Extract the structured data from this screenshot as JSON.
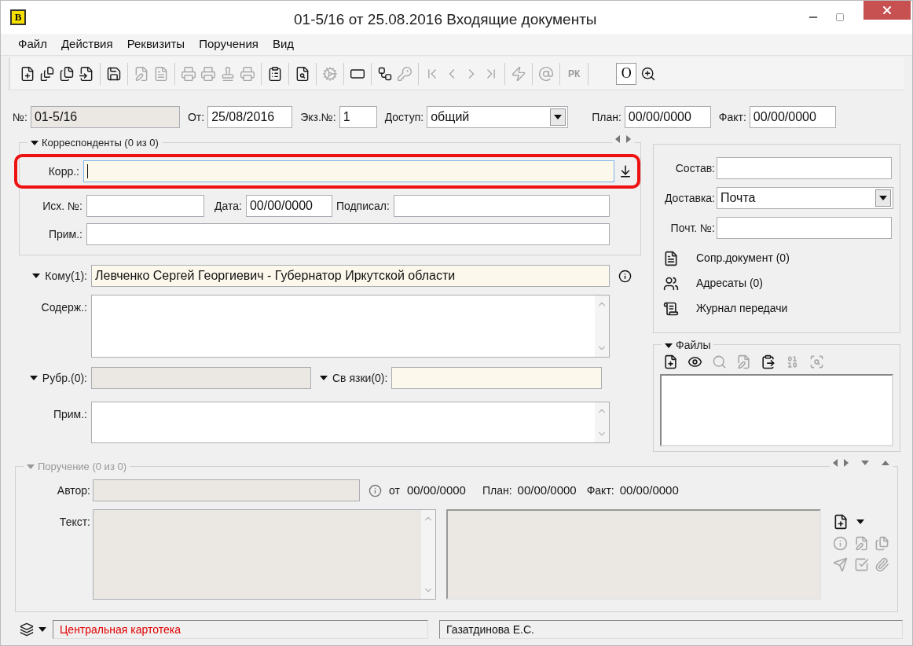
{
  "window": {
    "app_letter": "B",
    "title": "01-5/16 от 25.08.2016 Входящие документы"
  },
  "menu": [
    "Файл",
    "Действия",
    "Реквизиты",
    "Поручения",
    "Вид"
  ],
  "toolbar": [
    {
      "kind": "new",
      "disabled": false
    },
    {
      "kind": "newlist",
      "disabled": false
    },
    {
      "kind": "newcopy",
      "disabled": false
    },
    {
      "kind": "newlink",
      "disabled": false
    },
    {
      "kind": "separator"
    },
    {
      "kind": "save",
      "disabled": false
    },
    {
      "kind": "separator"
    },
    {
      "kind": "edit",
      "disabled": true
    },
    {
      "kind": "doc",
      "disabled": true
    },
    {
      "kind": "separator"
    },
    {
      "kind": "print",
      "disabled": true
    },
    {
      "kind": "printdoc",
      "disabled": true
    },
    {
      "kind": "stamp",
      "disabled": true
    },
    {
      "kind": "fax",
      "disabled": true
    },
    {
      "kind": "separator"
    },
    {
      "kind": "report",
      "disabled": false
    },
    {
      "kind": "separator"
    },
    {
      "kind": "finddoc",
      "disabled": false
    },
    {
      "kind": "separator"
    },
    {
      "kind": "gear",
      "disabled": true
    },
    {
      "kind": "separator"
    },
    {
      "kind": "field",
      "disabled": false
    },
    {
      "kind": "separator"
    },
    {
      "kind": "workflow",
      "disabled": false
    },
    {
      "kind": "key",
      "disabled": true
    },
    {
      "kind": "separator"
    },
    {
      "kind": "first",
      "disabled": true
    },
    {
      "kind": "prev",
      "disabled": true
    },
    {
      "kind": "next",
      "disabled": true
    },
    {
      "kind": "last",
      "disabled": true
    },
    {
      "kind": "separator"
    },
    {
      "kind": "lightning",
      "disabled": true
    },
    {
      "kind": "separator"
    },
    {
      "kind": "email",
      "disabled": true
    },
    {
      "kind": "separator"
    },
    {
      "kind": "lettered",
      "label": "РК",
      "disabled": true
    },
    {
      "kind": "separator"
    },
    {
      "kind": "toggle",
      "label": "О",
      "selected": true
    },
    {
      "kind": "zoom",
      "disabled": false
    }
  ],
  "header_fields": [
    {
      "label": "№:",
      "value": "01-5/16",
      "kind": "readonly"
    },
    {
      "label": "От:",
      "value": "25/08/2016",
      "kind": "text"
    },
    {
      "label": "Экз.№:",
      "value": "1",
      "kind": "text"
    },
    {
      "label": "Доступ:",
      "value": "общий",
      "kind": "select"
    },
    {
      "label": "План:",
      "value": "00/00/0000",
      "kind": "text"
    },
    {
      "label": "Факт:",
      "value": "00/00/0000",
      "kind": "text"
    }
  ],
  "correspondents": {
    "title": "Корреспонденты (0 из 0)",
    "expanded": true,
    "korr": {
      "label": "Корр.:",
      "focused": true,
      "highlighted": true
    },
    "out_number": {
      "label": "Исх. №:"
    },
    "date": {
      "label": "Дата:",
      "value": "00/00/0000"
    },
    "signed": {
      "label": "Подписал:"
    },
    "note": {
      "label": "Прим.:"
    }
  },
  "addressee": {
    "label": "Кому(1):",
    "value": "Левченко Сергей Георгиевич - Губернатор Иркутской области"
  },
  "content": {
    "label": "Содерж.:"
  },
  "rubrics": {
    "label": "Рубр.(0):"
  },
  "links": {
    "label": "Св язки(0):"
  },
  "note": {
    "label": "Прим.:"
  },
  "side_fields": [
    {
      "label": "Состав:",
      "kind": "text"
    },
    {
      "label": "Доставка:",
      "kind": "select",
      "value": "Почта"
    },
    {
      "label": "Почт. №:",
      "kind": "text"
    }
  ],
  "side_links": [
    {
      "label": "Сопр.документ (0)",
      "kind": "document"
    },
    {
      "label": "Адресаты (0)",
      "kind": "addressees"
    },
    {
      "label": "Журнал передачи",
      "kind": "journal"
    }
  ],
  "files": {
    "title": "Файлы",
    "tools": [
      {
        "kind": "new",
        "disabled": false
      },
      {
        "kind": "view",
        "disabled": false
      },
      {
        "kind": "search",
        "disabled": true
      },
      {
        "kind": "edit",
        "disabled": true
      },
      {
        "kind": "paste",
        "disabled": false
      },
      {
        "kind": "binedit",
        "disabled": true
      },
      {
        "kind": "binsearch",
        "disabled": true
      }
    ]
  },
  "assignment": {
    "title": "Поручение (0 из 0)",
    "disabled": true,
    "author_label": "Автор:",
    "from_label": "от",
    "from_value": "00/00/0000",
    "plan_label": "План:",
    "plan_value": "00/00/0000",
    "fact_label": "Факт:",
    "fact_value": "00/00/0000",
    "text_label": "Текст:",
    "tools": [
      {
        "kind": "info",
        "disabled": true
      },
      {
        "kind": "edit",
        "disabled": true
      },
      {
        "kind": "attach",
        "disabled": true
      },
      {
        "kind": "send",
        "disabled": true
      },
      {
        "kind": "check",
        "disabled": true
      },
      {
        "kind": "clip",
        "disabled": true
      }
    ]
  },
  "status_bar": {
    "cabinet": "Центральная картотека",
    "user": "Газатдинова Е.С."
  }
}
